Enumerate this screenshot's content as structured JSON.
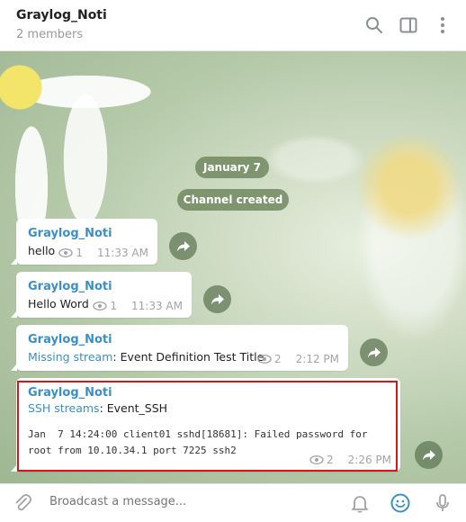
{
  "header": {
    "title": "Graylog_Noti",
    "subtitle": "2 members",
    "icons": [
      "search-icon",
      "sidebar-icon",
      "more-vertical-icon"
    ]
  },
  "date_pill": "January 7",
  "service_pill": "Channel created",
  "messages": [
    {
      "sender": "Graylog_Noti",
      "text": "hello",
      "views": "1",
      "time": "11:33 AM"
    },
    {
      "sender": "Graylog_Noti",
      "text": "Hello Word",
      "views": "1",
      "time": "11:33 AM"
    },
    {
      "sender": "Graylog_Noti",
      "link": "Missing stream",
      "text": ": Event Definition Test Title",
      "views": "2",
      "time": "2:12 PM"
    },
    {
      "sender": "Graylog_Noti",
      "link": "SSH streams",
      "text": ": Event_SSH",
      "log_line1": "Jan  7 14:24:00 client01 sshd[18681]: Failed password for",
      "log_line2": "root from 10.10.34.1 port 7225 ssh2",
      "views": "2",
      "time": "2:26 PM"
    }
  ],
  "composer": {
    "placeholder": "Broadcast a message...",
    "icons": [
      "attach-icon",
      "notification-bell-icon",
      "emoji-icon",
      "microphone-icon"
    ]
  },
  "colors": {
    "accent": "#3b8fc8",
    "highlight_border": "#d0191b",
    "pill": "#708860"
  }
}
